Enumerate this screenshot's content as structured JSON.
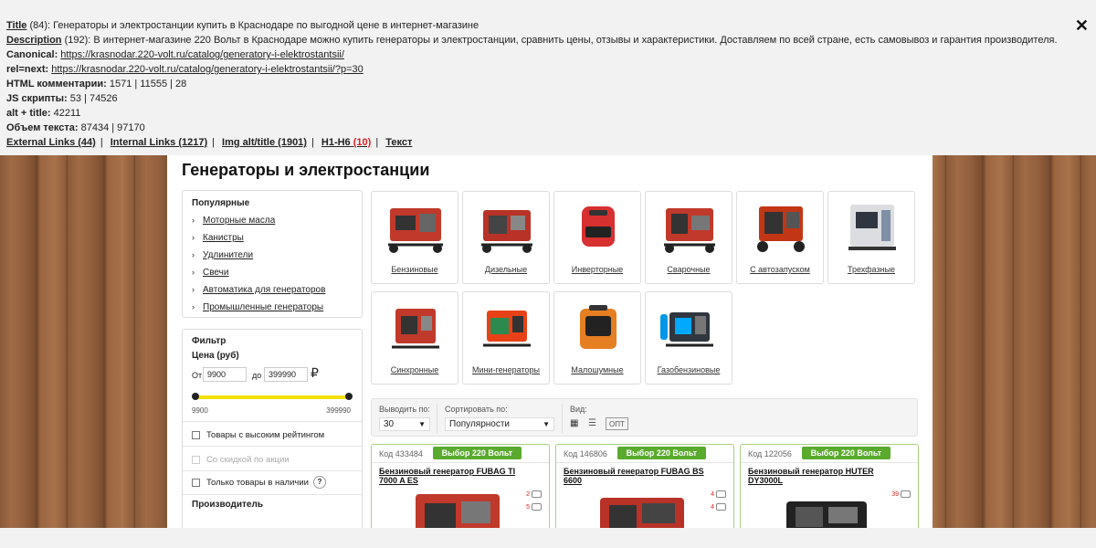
{
  "seo": {
    "title_key": "Title",
    "title_count": "(84):",
    "title_value_hl": "Генераторы и электростанции купить",
    "title_value_rest": " в Краснодаре по выгодной цене в интернет-магазине",
    "desc_key": "Description",
    "desc_count": "(192):",
    "desc_value": "В интернет-магазине 220 Вольт в Краснодаре можно купить генераторы и электростанции, сравнить цены, отзывы и характеристики. Доставляем по всей стране, есть самовывоз и гарантия производителя.",
    "canonical_key": "Canonical:",
    "canonical_value": "https://krasnodar.220-volt.ru/catalog/generatory-i-elektrostantsii/",
    "relnext_key": "rel=next:",
    "relnext_value": "https://krasnodar.220-volt.ru/catalog/generatory-i-elektrostantsii/?p=30",
    "html_comments_key": "HTML комментарии:",
    "html_comments_value": "1571 | 11555 | 28",
    "js_key": "JS скрипты:",
    "js_value": "53 | 74526",
    "alt_key": "alt + title:",
    "alt_value": "42211",
    "text_key": "Объем текста:",
    "text_value": "87434 | 97170",
    "links": {
      "external": "External Links (44)",
      "internal": "Internal Links (1217)",
      "img": "Img alt/title (1901)",
      "h_label": "H1-H6",
      "h_count": "(10)",
      "text": "Текст"
    },
    "close": "✕"
  },
  "page": {
    "title": "Генераторы и электростанции",
    "popular": {
      "header": "Популярные",
      "items": [
        "Моторные масла",
        "Канистры",
        "Удлинители",
        "Свечи",
        "Автоматика для генераторов",
        "Промышленные генераторы"
      ]
    },
    "filter": {
      "header": "Фильтр",
      "price_label": "Цена (руб)",
      "from_label": "От",
      "from_value": "9900",
      "to_label": "до",
      "to_value": "399990",
      "currency": "₽",
      "min_label": "9900",
      "max_label": "399990",
      "cb_rating": "Товары с высоким рейтингом",
      "cb_discount": "Со скидкой по акции",
      "cb_stock": "Только товары в наличии",
      "help": "?",
      "manufacturer": "Производитель"
    },
    "categories": [
      "Бензиновые",
      "Дизельные",
      "Инверторные",
      "Сварочные",
      "С автозапуском",
      "Трехфазные",
      "Синхронные",
      "Мини-генераторы",
      "Малошумные",
      "Газобензиновые"
    ],
    "toolbar": {
      "per_page_label": "Выводить по:",
      "per_page_value": "30",
      "sort_label": "Сортировать по:",
      "sort_value": "Популярности",
      "view_label": "Вид:",
      "view_opt": "ОПТ"
    },
    "products": [
      {
        "code": "Код 433484",
        "badge": "Выбор 220 Вольт",
        "name": "Бензиновый генератор FUBAG TI 7000 A ES",
        "reviews": "2",
        "videos": "5"
      },
      {
        "code": "Код 146806",
        "badge": "Выбор 220 Вольт",
        "name": "Бензиновый генератор FUBAG BS 6600",
        "reviews": "4",
        "videos": "4"
      },
      {
        "code": "Код 122056",
        "badge": "Выбор 220 Вольт",
        "name": "Бензиновый генератор HUTER DY3000L",
        "reviews": "39",
        "videos": ""
      }
    ]
  },
  "colors": {
    "accent_green": "#5aaa2e",
    "slider_yellow": "#f5e000",
    "highlight_green": "#8fd14f"
  }
}
